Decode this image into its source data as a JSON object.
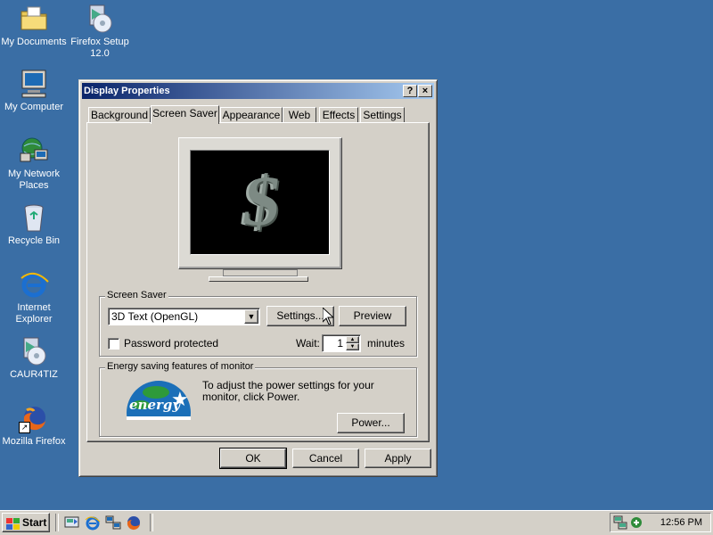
{
  "desktop": {
    "icons": [
      {
        "label": "My Documents"
      },
      {
        "label": "Firefox Setup 12.0"
      },
      {
        "label": "My Computer"
      },
      {
        "label": "My Network Places"
      },
      {
        "label": "Recycle Bin"
      },
      {
        "label": "Internet Explorer"
      },
      {
        "label": "CAUR4TIZ"
      },
      {
        "label": "Mozilla Firefox"
      }
    ]
  },
  "window": {
    "title": "Display Properties",
    "help_glyph": "?",
    "close_glyph": "×",
    "tabs": [
      {
        "label": "Background"
      },
      {
        "label": "Screen Saver",
        "active": true
      },
      {
        "label": "Appearance"
      },
      {
        "label": "Web"
      },
      {
        "label": "Effects"
      },
      {
        "label": "Settings"
      }
    ],
    "preview_glyph": "$",
    "screen_saver": {
      "group_label": "Screen Saver",
      "selected": "3D Text (OpenGL)",
      "settings_label": "Settings...",
      "preview_label": "Preview",
      "password_label": "Password protected",
      "password_checked": false,
      "wait_label": "Wait:",
      "wait_value": "1",
      "minutes_label": "minutes"
    },
    "energy": {
      "group_label": "Energy saving features of monitor",
      "description": "To adjust the power settings for your monitor, click Power.",
      "logo_text": "energy",
      "power_label": "Power..."
    },
    "buttons": {
      "ok": "OK",
      "cancel": "Cancel",
      "apply": "Apply"
    }
  },
  "taskbar": {
    "start_label": "Start",
    "clock": "12:56 PM"
  },
  "colors": {
    "desktop": "#3a6ea5",
    "face": "#d4d0c8",
    "title_start": "#0a246a",
    "title_end": "#a6caf0"
  }
}
